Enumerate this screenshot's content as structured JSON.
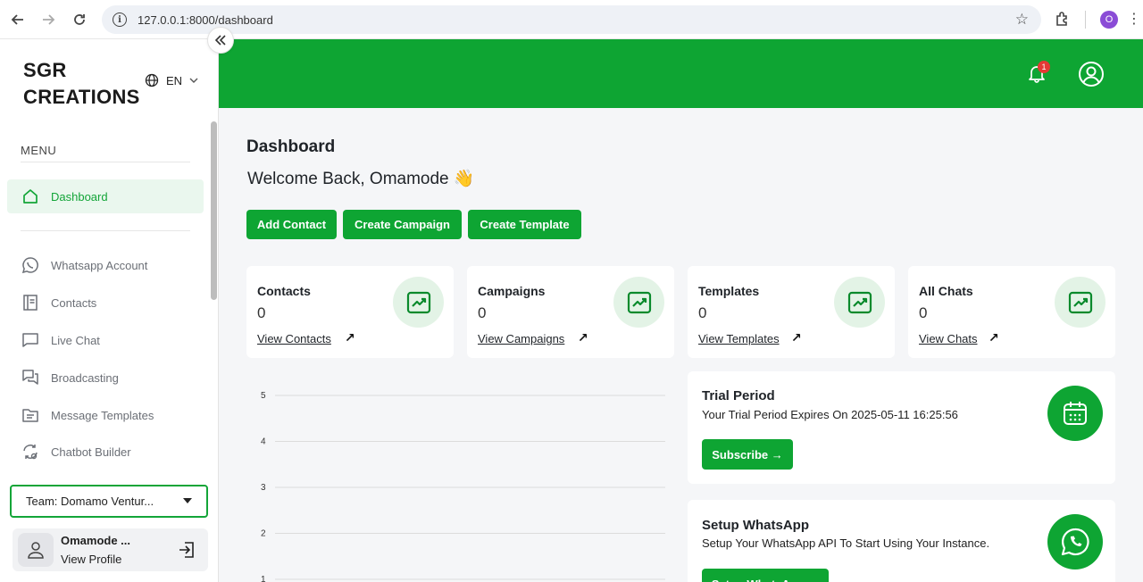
{
  "browser": {
    "url": "127.0.0.1:8000/dashboard",
    "profile_initial": "O"
  },
  "sidebar": {
    "brand": "SGR CREATIONS",
    "lang": "EN",
    "menu_title": "MENU",
    "items": [
      {
        "label": "Dashboard",
        "icon": "home-icon"
      },
      {
        "label": "Whatsapp Account",
        "icon": "whatsapp-icon"
      },
      {
        "label": "Contacts",
        "icon": "contacts-icon"
      },
      {
        "label": "Live Chat",
        "icon": "chat-icon"
      },
      {
        "label": "Broadcasting",
        "icon": "broadcast-icon"
      },
      {
        "label": "Message Templates",
        "icon": "template-icon"
      },
      {
        "label": "Chatbot Builder",
        "icon": "chatbot-icon"
      }
    ],
    "team": "Team: Domamo Ventur...",
    "user_name": "Omamode ...",
    "view_profile": "View Profile"
  },
  "topbar": {
    "notifications": "1"
  },
  "main": {
    "title": "Dashboard",
    "welcome": "Welcome Back, Omamode 👋",
    "buttons": [
      "Add Contact",
      "Create Campaign",
      "Create Template"
    ],
    "cards": [
      {
        "title": "Contacts",
        "value": "0",
        "link": "View Contacts"
      },
      {
        "title": "Campaigns",
        "value": "0",
        "link": "View Campaigns"
      },
      {
        "title": "Templates",
        "value": "0",
        "link": "View Templates"
      },
      {
        "title": "All Chats",
        "value": "0",
        "link": "View Chats"
      }
    ],
    "trial": {
      "title": "Trial Period",
      "text": "Your Trial Period Expires On 2025-05-11 16:25:56",
      "button": "Subscribe →"
    },
    "whatsapp": {
      "title": "Setup WhatsApp",
      "text": "Setup Your WhatsApp API To Start Using Your Instance.",
      "button": "Setup WhatsApp →"
    }
  },
  "chart_data": {
    "type": "line",
    "y_ticks": [
      "5",
      "4",
      "3",
      "2",
      "1"
    ],
    "ylim": [
      1,
      5
    ],
    "series": []
  },
  "colors": {
    "brand_green": "#0ea533",
    "active_bg": "#eaf7ee"
  }
}
